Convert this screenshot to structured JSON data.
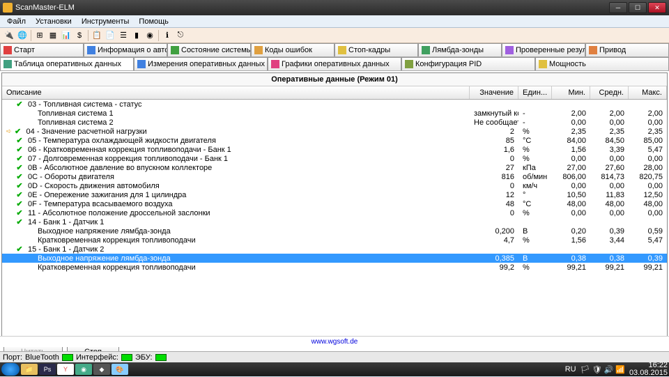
{
  "window": {
    "title": "ScanMaster-ELM"
  },
  "menu": [
    "Файл",
    "Установки",
    "Инструменты",
    "Помощь"
  ],
  "tabs_row1": [
    {
      "label": "Старт",
      "color": "#e04040"
    },
    {
      "label": "Информация о автомобиле",
      "color": "#4080e0"
    },
    {
      "label": "Состояние системы",
      "color": "#40a040"
    },
    {
      "label": "Коды ошибок",
      "color": "#e0a040"
    },
    {
      "label": "Стоп-кадры",
      "color": "#e0c040"
    },
    {
      "label": "Лямбда-зонды",
      "color": "#40a060"
    },
    {
      "label": "Проверенные результаты теста",
      "color": "#a060e0"
    },
    {
      "label": "Привод",
      "color": "#e08040"
    }
  ],
  "tabs_row2": [
    {
      "label": "Таблица оперативных данных",
      "color": "#40a080"
    },
    {
      "label": "Измерения оперативных данных",
      "color": "#4080e0"
    },
    {
      "label": "Графики оперативных данных",
      "color": "#e04080"
    },
    {
      "label": "Конфигурация PID",
      "color": "#80a040"
    },
    {
      "label": "Мощность",
      "color": "#e0c040"
    }
  ],
  "panel_title": "Оперативные данные (Режим 01)",
  "columns": {
    "desc": "Описание",
    "value": "Значение",
    "unit": "Един...",
    "min": "Мин.",
    "avg": "Средн.",
    "max": "Макс."
  },
  "rows": [
    {
      "chk": true,
      "indent": 0,
      "desc": "03 - Топливная система - статус",
      "v": "",
      "u": "",
      "min": "",
      "avg": "",
      "max": ""
    },
    {
      "chk": false,
      "indent": 1,
      "desc": "Топливная система 1",
      "v": "замкнутый кон...",
      "u": "-",
      "min": "2,00",
      "avg": "2,00",
      "max": "2,00"
    },
    {
      "chk": false,
      "indent": 1,
      "desc": "Топливная система 2",
      "v": "Не сообщается",
      "u": "-",
      "min": "0,00",
      "avg": "0,00",
      "max": "0,00"
    },
    {
      "chk": true,
      "arrow": true,
      "indent": 0,
      "desc": "04 - Значение расчетной нагрузки",
      "v": "2",
      "u": "%",
      "min": "2,35",
      "avg": "2,35",
      "max": "2,35"
    },
    {
      "chk": true,
      "indent": 0,
      "desc": "05 - Температура охлаждающей жидкости двигателя",
      "v": "85",
      "u": "°C",
      "min": "84,00",
      "avg": "84,50",
      "max": "85,00"
    },
    {
      "chk": true,
      "indent": 0,
      "desc": "06 - Кратковременная коррекция топливоподачи - Банк 1",
      "v": "1,6",
      "u": "%",
      "min": "1,56",
      "avg": "3,39",
      "max": "5,47"
    },
    {
      "chk": true,
      "indent": 0,
      "desc": "07 - Долговременная коррекция топливоподачи - Банк 1",
      "v": "0",
      "u": "%",
      "min": "0,00",
      "avg": "0,00",
      "max": "0,00"
    },
    {
      "chk": true,
      "indent": 0,
      "desc": "0B - Абсолютное давление во впускном коллекторе",
      "v": "27",
      "u": "кПа",
      "min": "27,00",
      "avg": "27,60",
      "max": "28,00"
    },
    {
      "chk": true,
      "indent": 0,
      "desc": "0C - Обороты двигателя",
      "v": "816",
      "u": "об/мин",
      "min": "806,00",
      "avg": "814,73",
      "max": "820,75"
    },
    {
      "chk": true,
      "indent": 0,
      "desc": "0D - Скорость движения автомобиля",
      "v": "0",
      "u": "км/ч",
      "min": "0,00",
      "avg": "0,00",
      "max": "0,00"
    },
    {
      "chk": true,
      "indent": 0,
      "desc": "0E - Опережение зажигания для 1 цилиндра",
      "v": "12",
      "u": "°",
      "min": "10,50",
      "avg": "11,83",
      "max": "12,50"
    },
    {
      "chk": true,
      "indent": 0,
      "desc": "0F - Температура всасываемого воздуха",
      "v": "48",
      "u": "°C",
      "min": "48,00",
      "avg": "48,00",
      "max": "48,00"
    },
    {
      "chk": true,
      "indent": 0,
      "desc": "11 - Абсолютное положение дроссельной заслонки",
      "v": "0",
      "u": "%",
      "min": "0,00",
      "avg": "0,00",
      "max": "0,00"
    },
    {
      "chk": true,
      "indent": 0,
      "desc": "14 - Банк 1 - Датчик 1",
      "v": "",
      "u": "",
      "min": "",
      "avg": "",
      "max": ""
    },
    {
      "chk": false,
      "indent": 1,
      "desc": "Выходное напряжение лямбда-зонда",
      "v": "0,200",
      "u": "В",
      "min": "0,20",
      "avg": "0,39",
      "max": "0,59"
    },
    {
      "chk": false,
      "indent": 1,
      "desc": "Кратковременная коррекция топливоподачи",
      "v": "4,7",
      "u": "%",
      "min": "1,56",
      "avg": "3,44",
      "max": "5,47"
    },
    {
      "chk": true,
      "indent": 0,
      "desc": "15 - Банк 1 - Датчик 2",
      "v": "",
      "u": "",
      "min": "",
      "avg": "",
      "max": ""
    },
    {
      "chk": false,
      "indent": 1,
      "selected": true,
      "desc": "Выходное напряжение лямбда-зонда",
      "v": "0,385",
      "u": "В",
      "min": "0,38",
      "avg": "0,38",
      "max": "0,39"
    },
    {
      "chk": false,
      "indent": 1,
      "desc": "Кратковременная коррекция топливоподачи",
      "v": "99,2",
      "u": "%",
      "min": "99,21",
      "avg": "99,21",
      "max": "99,21"
    }
  ],
  "buttons": {
    "read": "Читать",
    "stop": "Стоп"
  },
  "footer_link": "www.wgsoft.de",
  "status": {
    "port": "Порт:",
    "port_v": "BlueTooth",
    "iface": "Интерфейс:",
    "ecu": "ЭБУ:"
  },
  "tray": {
    "lang": "RU",
    "time": "16:22",
    "date": "03.08.2015"
  }
}
